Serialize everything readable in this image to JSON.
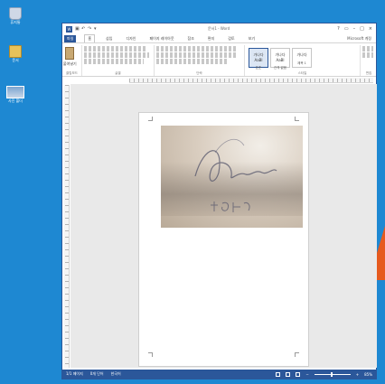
{
  "desktop": {
    "icons": [
      {
        "name": "recycle-bin",
        "label": "휴지통"
      },
      {
        "name": "folder",
        "label": "문서"
      },
      {
        "name": "photo",
        "label": "사진 폴더"
      }
    ],
    "colors": {
      "background": "#1e88d2",
      "accent": "#e65a1e"
    }
  },
  "word": {
    "title": "문서1 - Word",
    "app_icon": "W",
    "window_controls": [
      "?",
      "▭",
      "–",
      "□",
      "×"
    ],
    "tabs": [
      "파일",
      "홈",
      "삽입",
      "디자인",
      "페이지 레이아웃",
      "참조",
      "편지",
      "검토",
      "보기"
    ],
    "user": "Microsoft 계정",
    "ribbon": {
      "clipboard": {
        "paste": "붙여넣기",
        "label": "클립보드"
      },
      "font_label": "글꼴",
      "paragraph_label": "단락",
      "styles": [
        {
          "sample": "가나다AaBl",
          "name": "표준"
        },
        {
          "sample": "가나다AaBl",
          "name": "간격 없음"
        },
        {
          "sample": "가나다",
          "name": "제목 1"
        }
      ],
      "styles_label": "스타일",
      "editing_label": "편집"
    },
    "status": {
      "page": "1/1 페이지",
      "words": "0개 단어",
      "language": "한국어",
      "zoom": "85%"
    },
    "colors": {
      "brand": "#2b579a"
    }
  },
  "document": {
    "image": {
      "name": "signature-photo",
      "strokes": "handwritten"
    }
  }
}
